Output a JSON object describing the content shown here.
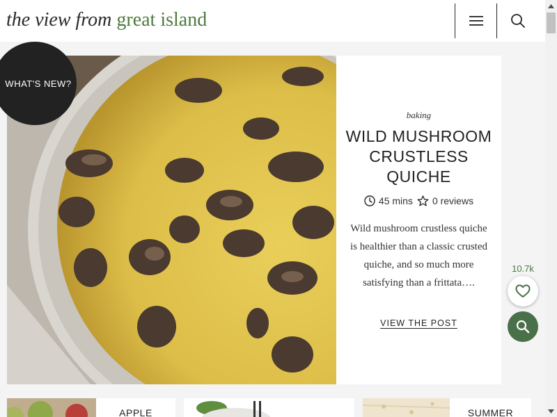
{
  "header": {
    "logo_part1": "the view from",
    "logo_part2": "great island"
  },
  "hero": {
    "category": "baking",
    "title": "WILD MUSHROOM CRUSTLESS QUICHE",
    "time": "45 mins",
    "reviews": "0 reviews",
    "description": "Wild mushroom crustless quiche is healthier than a classic crusted quiche, and so much more satisfying than a frittata….",
    "cta": "VIEW THE POST"
  },
  "whats_new": "WHAT'S NEW?",
  "favorites": {
    "count": "10.7k"
  },
  "bottom_cards": [
    {
      "label": "APPLE"
    },
    {
      "label": ""
    },
    {
      "label": "SUMMER"
    }
  ],
  "colors": {
    "brand_green": "#4e7a3e",
    "fab_green": "#4a7049",
    "dark": "#222222"
  },
  "icons": [
    "menu-icon",
    "search-icon",
    "clock-icon",
    "star-icon",
    "heart-icon",
    "arrow-up-icon",
    "arrow-down-icon"
  ]
}
